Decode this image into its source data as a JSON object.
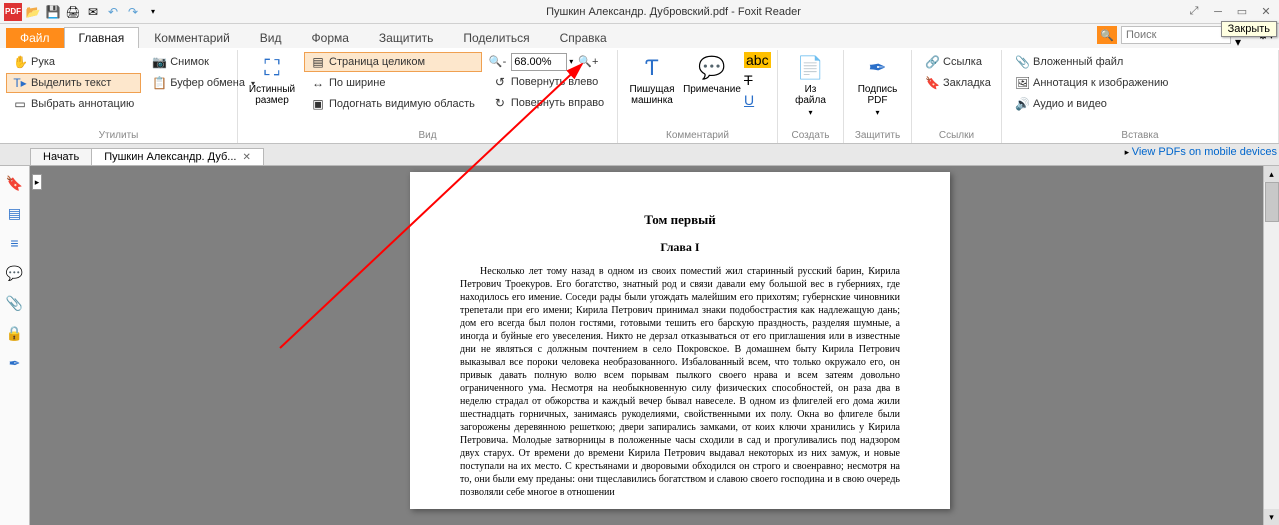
{
  "titlebar": {
    "title": "Пушкин Александр. Дубровский.pdf - Foxit Reader",
    "close_tooltip": "Закрыть"
  },
  "tabs": {
    "file": "Файл",
    "items": [
      "Главная",
      "Комментарий",
      "Вид",
      "Форма",
      "Защитить",
      "Поделиться",
      "Справка"
    ],
    "active_index": 0,
    "search_placeholder": "Поиск"
  },
  "ribbon": {
    "groups": {
      "utilities": {
        "label": "Утилиты",
        "hand": "Рука",
        "select_text": "Выделить текст",
        "select_annot": "Выбрать аннотацию",
        "snapshot": "Снимок",
        "clipboard": "Буфер обмена"
      },
      "view": {
        "label": "Вид",
        "actual_size": "Истинный размер",
        "fit_page": "Страница целиком",
        "fit_width": "По ширине",
        "fit_visible": "Подогнать видимую область",
        "zoom_value": "68.00%",
        "rotate_left": "Повернуть влево",
        "rotate_right": "Повернуть вправо"
      },
      "comment": {
        "label": "Комментарий",
        "typewriter": "Пишущая машинка",
        "note": "Примечание"
      },
      "create": {
        "label": "Создать",
        "from_file": "Из файла"
      },
      "protect": {
        "label": "Защитить",
        "sign": "Подпись PDF"
      },
      "links": {
        "label": "Ссылки",
        "link": "Ссылка",
        "bookmark": "Закладка"
      },
      "insert": {
        "label": "Вставка",
        "attach": "Вложенный файл",
        "image_annot": "Аннотация к изображению",
        "av": "Аудио и видео"
      }
    }
  },
  "doc_tabs": {
    "start": "Начать",
    "doc": "Пушкин Александр. Дуб...",
    "promo": "View PDFs on mobile devices"
  },
  "page": {
    "volume": "Том первый",
    "chapter": "Глава I",
    "body": "Несколько лет тому назад в одном из своих поместий жил старинный русский барин, Кирила Петрович Троекуров. Его богатство, знатный род и связи давали ему большой вес в губерниях, где находилось его имение. Соседи рады были угождать малейшим его прихотям; губернские чиновники трепетали при его имени; Кирила Петрович принимал знаки подобострастия как надлежащую дань; дом его всегда был полон гостями, готовыми тешить его барскую праздность, разделяя шумные, а иногда и буйные его увеселения. Никто не дерзал отказываться от его приглашения или в известные дни не являться с должным почтением в село Покровское. В домашнем быту Кирила Петрович выказывал все пороки человека необразованного. Избалованный всем, что только окружало его, он привык давать полную волю всем порывам пылкого своего нрава и всем затеям довольно ограниченного ума. Несмотря на необыкновенную силу физических способностей, он раза два в неделю страдал от обжорства и каждый вечер бывал навеселе. В одном из флигелей его дома жили шестнадцать горничных, занимаясь рукоделиями, свойственными их полу. Окна во флигеле были загорожены деревянною решеткою; двери запирались замками, от коих ключи хранились у Кирила Петровича. Молодые затворницы в положенные часы сходили в сад и прогуливались под надзором двух старух. От времени до времени Кирила Петрович выдавал некоторых из них замуж, и новые поступали на их место. С крестьянами и дворовыми обходился он строго и своенравно; несмотря на то, они были ему преданы: они тщеславились богатством и славою своего господина и в свою очередь позволяли себе многое в отношении"
  }
}
